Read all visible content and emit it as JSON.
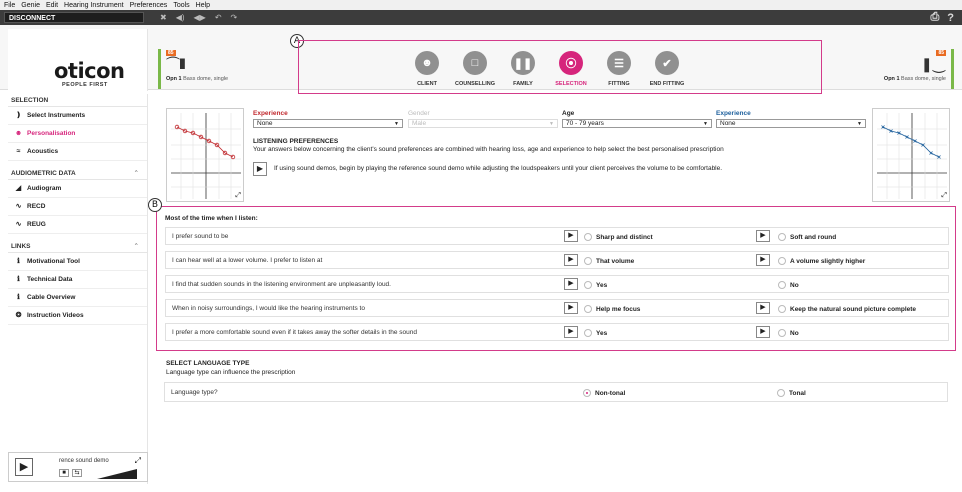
{
  "menu": [
    "File",
    "Genie",
    "Edit",
    "Hearing Instrument",
    "Preferences",
    "Tools",
    "Help"
  ],
  "toolbar": {
    "disconnect_label": "DISCONNECT",
    "help_glyph": "?"
  },
  "brand": {
    "logo": "oticon",
    "tagline": "PEOPLE FIRST"
  },
  "devices": {
    "left": {
      "tag": "85",
      "model": "Opn 1",
      "fitting": "Bass dome, single",
      "color": "#7ab848"
    },
    "right": {
      "tag": "85",
      "model": "Opn 1",
      "fitting": "Bass dome, single",
      "color": "#7ab848"
    }
  },
  "callouts": {
    "a": "A",
    "b": "B"
  },
  "workflow": {
    "steps": [
      {
        "label": "CLIENT",
        "icon": "client-icon",
        "active": false
      },
      {
        "label": "COUNSELLING",
        "icon": "counselling-icon",
        "active": false
      },
      {
        "label": "FAMILY",
        "icon": "family-icon",
        "active": false
      },
      {
        "label": "SELECTION",
        "icon": "selection-icon",
        "active": true
      },
      {
        "label": "FITTING",
        "icon": "fitting-icon",
        "active": false
      },
      {
        "label": "END FITTING",
        "icon": "end-fitting-icon",
        "active": false
      }
    ],
    "active_color": "#d6257c"
  },
  "sidebar": {
    "selection": {
      "title": "SELECTION",
      "items": [
        "Select Instruments",
        "Personalisation",
        "Acoustics"
      ]
    },
    "audiometric": {
      "title": "AUDIOMETRIC DATA",
      "items": [
        "Audiogram",
        "RECD",
        "REUG"
      ]
    },
    "links": {
      "title": "LINKS",
      "items": [
        "Motivational Tool",
        "Technical Data",
        "Cable Overview",
        "Instruction Videos"
      ]
    },
    "player_text": "rence sound demo"
  },
  "fields": {
    "experience_left": {
      "label": "Experience",
      "value": "None"
    },
    "gender": {
      "label": "Gender",
      "value": "Male"
    },
    "age": {
      "label": "Age",
      "value": "70 - 79 years"
    },
    "experience_right": {
      "label": "Experience",
      "value": "None"
    }
  },
  "listening": {
    "title": "LISTENING PREFERENCES",
    "description": "Your answers below concerning the client's sound preferences are combined with hearing loss, age and experience to help select the best personalised prescription",
    "demo_hint": "If using sound demos, begin by playing the reference sound demo while adjusting the loudspeakers until your client perceives the volume to be comfortable."
  },
  "questions": {
    "heading": "Most of the time when I listen:",
    "rows": [
      {
        "text": "I prefer sound to be",
        "option_a": "Sharp and distinct",
        "option_b": "Soft and round"
      },
      {
        "text": "I can hear well at a lower volume. I prefer to listen at",
        "option_a": "That volume",
        "option_b": "A volume slightly higher"
      },
      {
        "text": "I find that sudden sounds in the listening environment are unpleasantly loud.",
        "option_a": "Yes",
        "option_b": "No"
      },
      {
        "text": "When in noisy surroundings, I would like the hearing instruments to",
        "option_a": "Help me focus",
        "option_b": "Keep the natural sound picture complete"
      },
      {
        "text": "I prefer a more comfortable sound even if it takes away the softer details in the sound",
        "option_a": "Yes",
        "option_b": "No"
      }
    ]
  },
  "language": {
    "title": "SELECT LANGUAGE TYPE",
    "subtitle": "Language type can influence the prescription",
    "question": "Language type?",
    "option_a": "Non-tonal",
    "option_b": "Tonal",
    "selected": "Non-tonal"
  }
}
